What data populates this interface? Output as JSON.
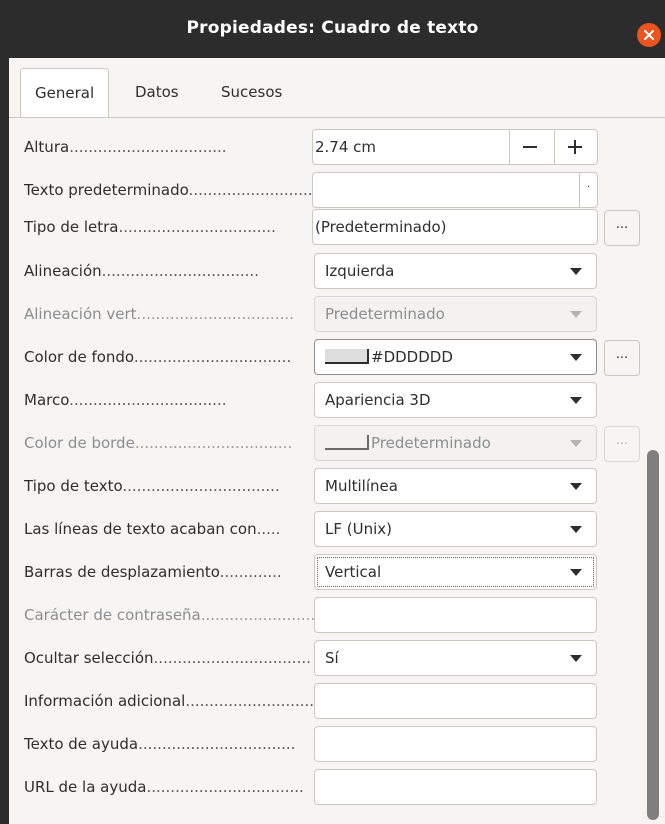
{
  "window": {
    "title": "Propiedades: Cuadro de texto"
  },
  "tabs": [
    {
      "label": "General"
    },
    {
      "label": "Datos"
    },
    {
      "label": "Sucesos"
    }
  ],
  "rows": [
    {
      "label": "Altura",
      "value": "2.74 cm"
    },
    {
      "label": "Texto predeterminado",
      "value": ""
    },
    {
      "label": "Tipo de letra",
      "value": "(Predeterminado)",
      "button": "..."
    },
    {
      "label": "Alineación",
      "value": "Izquierda"
    },
    {
      "label": "Alineación vert",
      "value": "Predeterminado"
    },
    {
      "label": "Color de fondo",
      "value": "#DDDDDD",
      "button": "..."
    },
    {
      "label": "Marco",
      "value": "Apariencia 3D"
    },
    {
      "label": "Color de borde",
      "value": "Predeterminado",
      "button": "..."
    },
    {
      "label": "Tipo de texto",
      "value": "Multilínea"
    },
    {
      "label": "Las líneas de texto acaban con",
      "value": "LF (Unix)"
    },
    {
      "label": "Barras de desplazamiento",
      "value": "Vertical"
    },
    {
      "label": "Carácter de contraseña",
      "value": ""
    },
    {
      "label": "Ocultar selección",
      "value": "Sí"
    },
    {
      "label": "Información adicional",
      "value": ""
    },
    {
      "label": "Texto de ayuda",
      "value": ""
    },
    {
      "label": "URL de la ayuda",
      "value": ""
    }
  ],
  "colors": {
    "titlebar": "#2c2c2c",
    "close_button": "#e95420",
    "background": "#f6f5f4",
    "swatch_fondo": "#dddddd"
  },
  "icons": {
    "close": "close-icon",
    "dropdown": "chevron-down-icon",
    "minus": "minus-icon",
    "plus": "plus-icon"
  }
}
